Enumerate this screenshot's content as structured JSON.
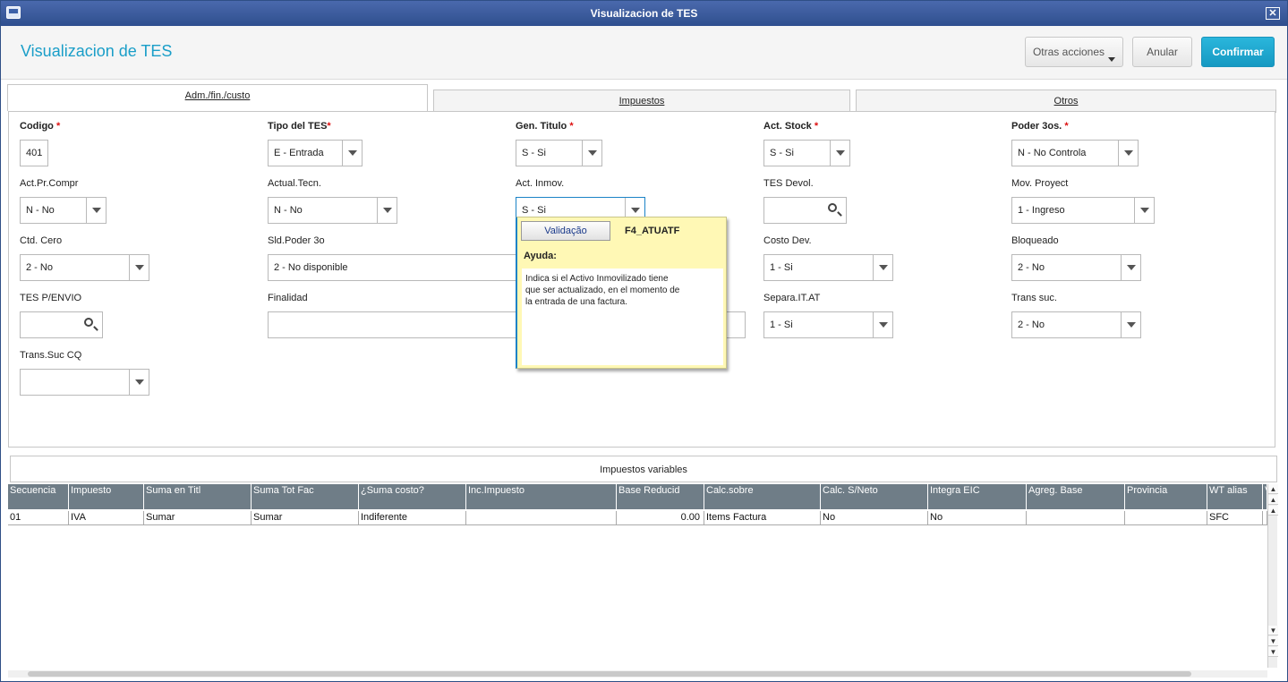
{
  "window": {
    "title": "Visualizacion de TES"
  },
  "header": {
    "title": "Visualizacion de TES",
    "buttons": {
      "otras": "Otras acciones",
      "anular": "Anular",
      "confirmar": "Confirmar"
    }
  },
  "tabs": [
    "Adm./fin./custo",
    "Impuestos",
    "Otros"
  ],
  "fields": {
    "codigo": {
      "label": "Codigo",
      "value": "401"
    },
    "tipo_tes": {
      "label": "Tipo del TES",
      "value": "E - Entrada"
    },
    "gen_titulo": {
      "label": "Gen. Titulo",
      "value": "S - Si"
    },
    "act_stock": {
      "label": "Act. Stock",
      "value": "S - Si"
    },
    "poder3os": {
      "label": "Poder 3os.",
      "value": "N - No Controla"
    },
    "act_pr_compr": {
      "label": "Act.Pr.Compr",
      "value": "N - No"
    },
    "actual_tecn": {
      "label": "Actual.Tecn.",
      "value": "N - No"
    },
    "act_inmov": {
      "label": "Act. Inmov.",
      "value": "S - Si"
    },
    "tes_devol": {
      "label": "TES Devol.",
      "value": ""
    },
    "mov_proyect": {
      "label": "Mov. Proyect",
      "value": "1 - Ingreso"
    },
    "ctd_cero": {
      "label": "Ctd. Cero",
      "value": "2 - No"
    },
    "sld_poder3o": {
      "label": "Sld.Poder 3o",
      "value": "2 - No disponible"
    },
    "costo_dev": {
      "label": "Costo Dev.",
      "value": "1 - Si"
    },
    "bloqueado": {
      "label": "Bloqueado",
      "value": "2 - No"
    },
    "tes_penvio": {
      "label": "TES P/ENVIO",
      "value": ""
    },
    "finalidad": {
      "label": "Finalidad",
      "value": ""
    },
    "separa_it_at": {
      "label": "Separa.IT.AT",
      "value": "1 - Si"
    },
    "trans_suc": {
      "label": "Trans suc.",
      "value": "2 - No"
    },
    "trans_suc_cq": {
      "label": "Trans.Suc CQ",
      "value": ""
    }
  },
  "tooltip": {
    "button": "Validação",
    "code": "F4_ATUATF",
    "ayuda_label": "Ayuda:",
    "help_lines": [
      "Indica si el Activo Inmovilizado tiene",
      "que ser actualizado, en el momento de",
      "la entrada de una factura."
    ]
  },
  "table": {
    "caption": "Impuestos variables",
    "columns": [
      "Secuencia",
      "Impuesto",
      "Suma en Titl",
      "Suma Tot Fac",
      "¿Suma costo?",
      "Inc.Impuesto",
      "Base Reducid",
      "Calc.sobre",
      "Calc. S/Neto",
      "Integra EIC",
      "Agreg. Base",
      "Provincia",
      "WT alias",
      "V"
    ],
    "rows": [
      [
        "01",
        "IVA",
        "Sumar",
        "Sumar",
        "Indiferente",
        "",
        "0.00",
        "Items Factura",
        "No",
        "No",
        "",
        "",
        "SFC",
        ""
      ]
    ]
  }
}
